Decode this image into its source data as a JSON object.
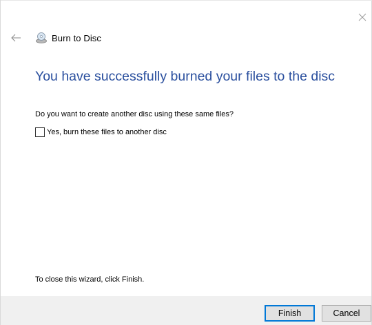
{
  "window": {
    "title": "Burn to Disc",
    "close_icon": "close-icon",
    "back_icon": "back-arrow-icon",
    "title_icon": "disc-drive-icon"
  },
  "content": {
    "heading": "You have successfully burned your files to the disc",
    "question": "Do you want to create another disc using these same files?",
    "checkbox": {
      "label": "Yes, burn these files to another disc",
      "checked": false
    },
    "close_hint": "To close this wizard, click Finish."
  },
  "buttons": {
    "finish": "Finish",
    "cancel": "Cancel"
  },
  "colors": {
    "heading": "#2a4f9e",
    "footer_bg": "#f0f0f0",
    "default_button_border": "#0078d7"
  }
}
